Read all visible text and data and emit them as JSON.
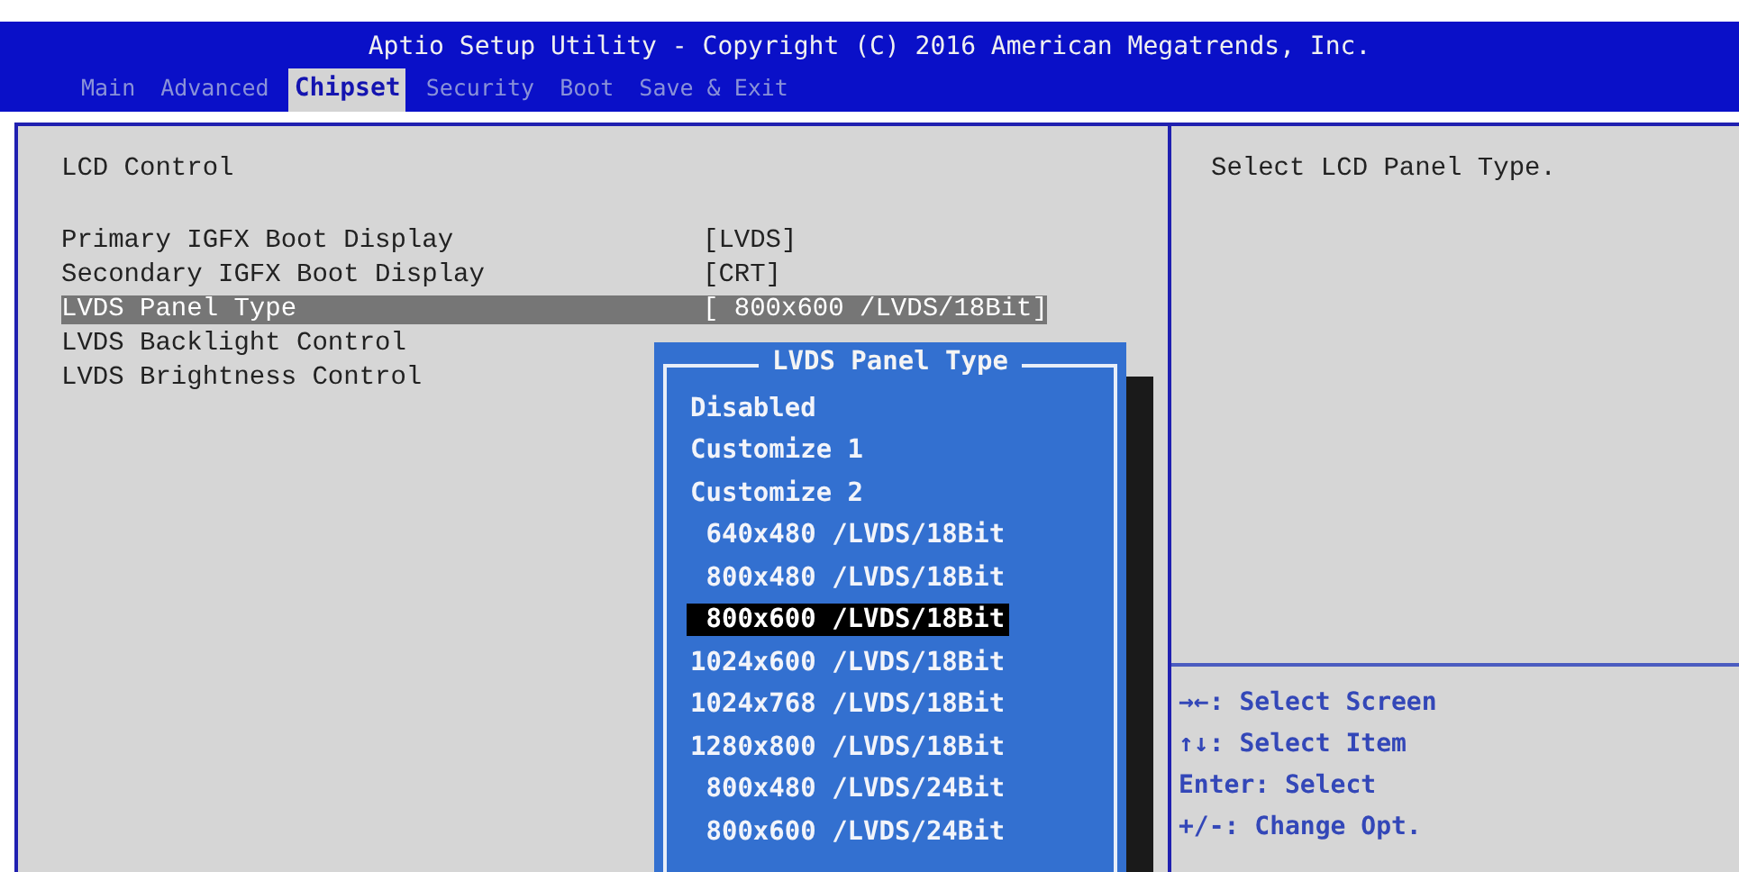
{
  "window": {
    "title": "Aptio Setup Utility - Copyright (C) 2016 American Megatrends, Inc."
  },
  "tabs": [
    {
      "label": "Main",
      "selected": false
    },
    {
      "label": "Advanced",
      "selected": false
    },
    {
      "label": "Chipset",
      "selected": true
    },
    {
      "label": "Security",
      "selected": false
    },
    {
      "label": "Boot",
      "selected": false
    },
    {
      "label": "Save & Exit",
      "selected": false
    }
  ],
  "section_title": "LCD Control",
  "settings": [
    {
      "label": "Primary IGFX Boot Display",
      "value": "[LVDS]",
      "selected": false
    },
    {
      "label": "Secondary IGFX Boot Display",
      "value": "[CRT]",
      "selected": false
    },
    {
      "label": "LVDS Panel Type",
      "value": "[ 800x600 /LVDS/18Bit]",
      "selected": true
    },
    {
      "label": "LVDS Backlight Control",
      "selected": false
    },
    {
      "label": "LVDS Brightness Control",
      "selected": false
    }
  ],
  "help": {
    "text": "Select LCD Panel Type.",
    "keys": [
      "→←: Select Screen",
      "↑↓: Select Item",
      "Enter: Select",
      "+/-: Change Opt."
    ]
  },
  "popup": {
    "title": "LVDS Panel Type",
    "options": [
      {
        "label": "Disabled",
        "selected": false
      },
      {
        "label": "Customize 1",
        "selected": false
      },
      {
        "label": "Customize 2",
        "selected": false
      },
      {
        "label": " 640x480 /LVDS/18Bit",
        "selected": false
      },
      {
        "label": " 800x480 /LVDS/18Bit",
        "selected": false
      },
      {
        "label": " 800x600 /LVDS/18Bit",
        "selected": true
      },
      {
        "label": "1024x600 /LVDS/18Bit",
        "selected": false
      },
      {
        "label": "1024x768 /LVDS/18Bit",
        "selected": false
      },
      {
        "label": "1280x800 /LVDS/18Bit",
        "selected": false
      },
      {
        "label": " 800x480 /LVDS/24Bit",
        "selected": false
      },
      {
        "label": " 800x600 /LVDS/24Bit",
        "selected": false
      }
    ]
  }
}
